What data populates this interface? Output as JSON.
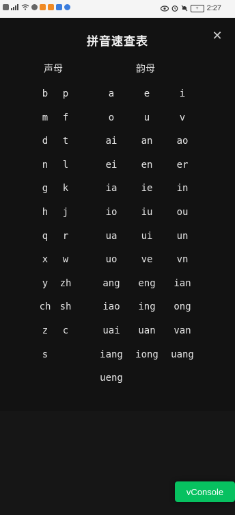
{
  "status_bar": {
    "time": "2:27",
    "battery_label": "+"
  },
  "dialog": {
    "title": "拼音速查表",
    "close_symbol": "✕",
    "initials_header": "声母",
    "finals_header": "韵母"
  },
  "initials": [
    [
      "b",
      "p"
    ],
    [
      "m",
      "f"
    ],
    [
      "d",
      "t"
    ],
    [
      "n",
      "l"
    ],
    [
      "g",
      "k"
    ],
    [
      "h",
      "j"
    ],
    [
      "q",
      "r"
    ],
    [
      "x",
      "w"
    ],
    [
      "y",
      "zh"
    ],
    [
      "ch",
      "sh"
    ],
    [
      "z",
      "c"
    ],
    [
      "s",
      ""
    ]
  ],
  "finals": [
    [
      "a",
      "e",
      "i"
    ],
    [
      "o",
      "u",
      "v"
    ],
    [
      "ai",
      "an",
      "ao"
    ],
    [
      "ei",
      "en",
      "er"
    ],
    [
      "ia",
      "ie",
      "in"
    ],
    [
      "io",
      "iu",
      "ou"
    ],
    [
      "ua",
      "ui",
      "un"
    ],
    [
      "uo",
      "ve",
      "vn"
    ],
    [
      "ang",
      "eng",
      "ian"
    ],
    [
      "iao",
      "ing",
      "ong"
    ],
    [
      "uai",
      "uan",
      "van"
    ],
    [
      "iang",
      "iong",
      "uang"
    ],
    [
      "ueng",
      "",
      ""
    ]
  ],
  "vconsole": {
    "label": "vConsole",
    "color": "#07c160"
  }
}
